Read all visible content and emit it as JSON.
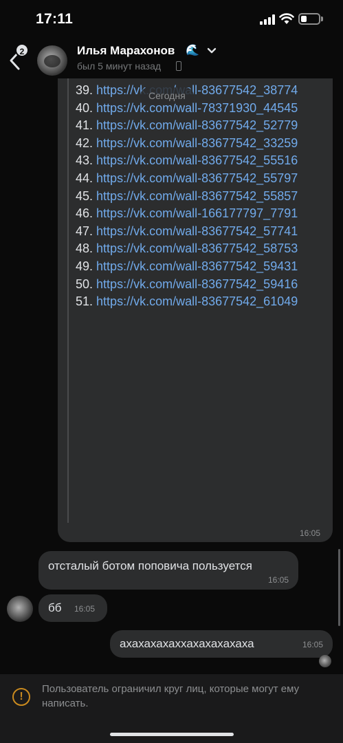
{
  "status_bar": {
    "time": "17:11"
  },
  "header": {
    "back_badge": "2",
    "contact_name": "Илья Марахонов",
    "contact_emoji": "🌊",
    "contact_status": "был 5 минут назад",
    "icons": [
      "back-arrow-icon",
      "chevron-down-icon",
      "mobile-phone-icon"
    ]
  },
  "date_separator": "Сегодня",
  "link_list": [
    {
      "num": "39.",
      "link": "https://vk.com/wall-83677542_38774"
    },
    {
      "num": "40.",
      "link": "https://vk.com/wall-78371930_44545"
    },
    {
      "num": "41.",
      "link": "https://vk.com/wall-83677542_52779"
    },
    {
      "num": "42.",
      "link": "https://vk.com/wall-83677542_33259"
    },
    {
      "num": "43.",
      "link": "https://vk.com/wall-83677542_55516"
    },
    {
      "num": "44.",
      "link": "https://vk.com/wall-83677542_55797"
    },
    {
      "num": "45.",
      "link": "https://vk.com/wall-83677542_55857"
    },
    {
      "num": "46.",
      "link": "https://vk.com/wall-166177797_7791"
    },
    {
      "num": "47.",
      "link": "https://vk.com/wall-83677542_57741"
    },
    {
      "num": "48.",
      "link": "https://vk.com/wall-83677542_58753"
    },
    {
      "num": "49.",
      "link": "https://vk.com/wall-83677542_59431"
    },
    {
      "num": "50.",
      "link": "https://vk.com/wall-83677542_59416"
    },
    {
      "num": "51.",
      "link": "https://vk.com/wall-83677542_61049"
    }
  ],
  "messages": {
    "list_time": "16:05",
    "m1": {
      "text": "отсталый ботом поповича пользуется",
      "time": "16:05"
    },
    "m2": {
      "text": "бб",
      "time": "16:05"
    },
    "m3": {
      "text": "ахахахахаххахахахахаха",
      "time": "16:05"
    }
  },
  "notice": {
    "icon": "warning-circle-icon",
    "text": "Пользователь ограничил круг лиц, которые могут ему написать."
  },
  "colors": {
    "background": "#0a0a0a",
    "bubble": "#2c2d2e",
    "link": "#71aaeb",
    "warning": "#c98a1f"
  }
}
